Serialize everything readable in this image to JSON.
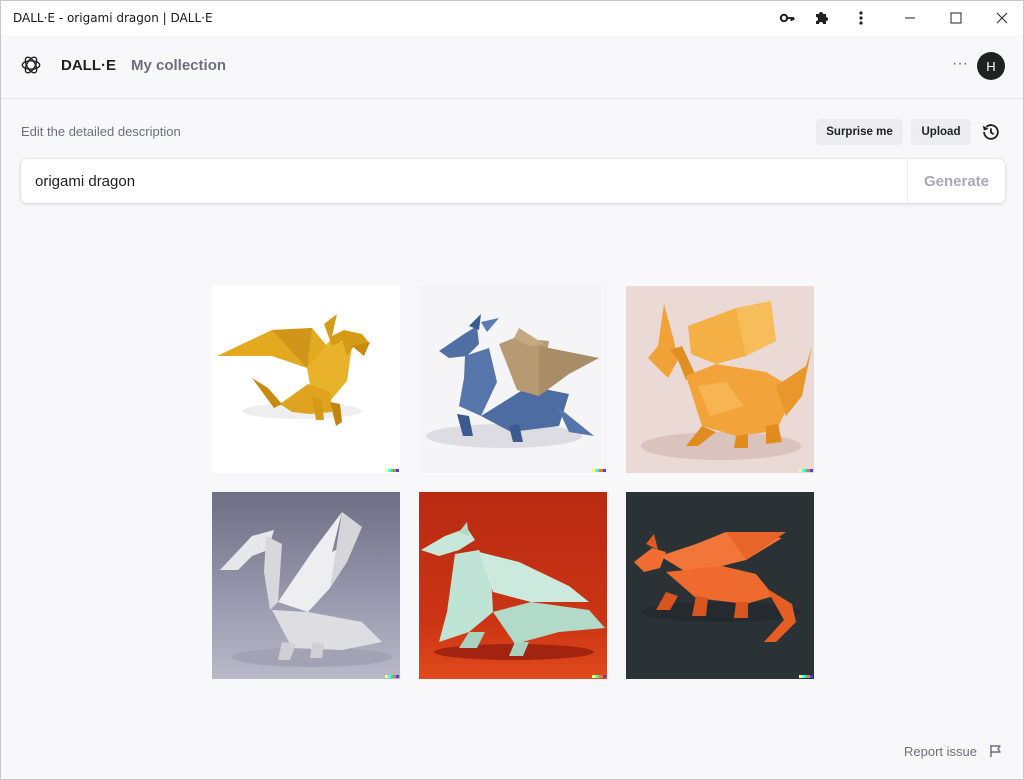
{
  "window": {
    "title": "DALL·E - origami dragon | DALL·E",
    "controls": [
      "minimize",
      "maximize",
      "close"
    ],
    "toolbar_icons": [
      "key-icon",
      "puzzle-icon",
      "kebab-menu-icon"
    ]
  },
  "header": {
    "brand": "DALL·E",
    "nav_collection": "My collection",
    "more_label": "···",
    "avatar_initial": "H"
  },
  "prompt": {
    "label": "Edit the detailed description",
    "surprise_label": "Surprise me",
    "upload_label": "Upload",
    "value": "origami dragon",
    "generate_label": "Generate"
  },
  "results": [
    {
      "id": "img-1",
      "subject": "yellow origami dragon",
      "background": "#ffffff",
      "color": "#e0a71c"
    },
    {
      "id": "img-2",
      "subject": "blue origami dragon with tan wings",
      "background": "#f4f4f6",
      "color": "#5a78ad"
    },
    {
      "id": "img-3",
      "subject": "orange origami dragon",
      "background": "#e8d9d5",
      "color": "#f2a33a"
    },
    {
      "id": "img-4",
      "subject": "white origami dragon",
      "background": "#9090a6",
      "color": "#e4e4e6"
    },
    {
      "id": "img-5",
      "subject": "mint origami dragon",
      "background": "#c02c10",
      "color": "#bfe3d4"
    },
    {
      "id": "img-6",
      "subject": "orange origami dragon on dark",
      "background": "#2b3134",
      "color": "#f06a30"
    }
  ],
  "signature_colors": [
    "#ffff66",
    "#42ffff",
    "#51da4c",
    "#ff6e3c",
    "#3c46ff"
  ],
  "footer": {
    "report_label": "Report issue"
  }
}
